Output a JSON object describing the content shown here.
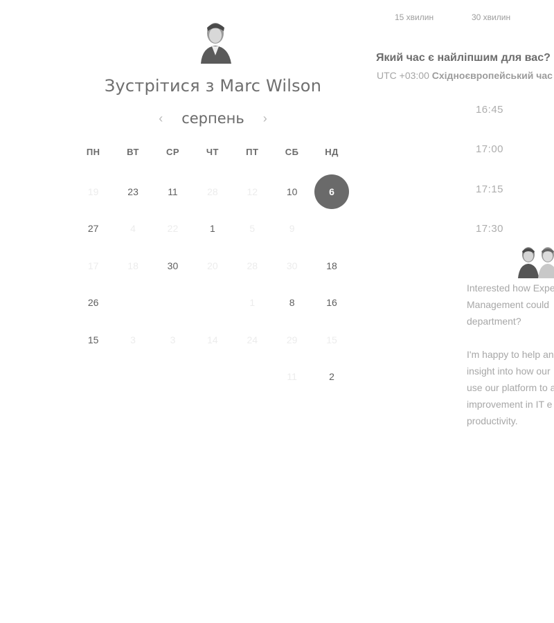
{
  "host": {
    "title": "Зустрітися з Marc Wilson",
    "avatar_icon": "person-portrait-icon"
  },
  "calendar": {
    "month": "серпень",
    "prev_icon": "chevron-left-icon",
    "next_icon": "chevron-right-icon",
    "weekdays": [
      "ПН",
      "ВТ",
      "СР",
      "ЧТ",
      "ПТ",
      "СБ",
      "НД"
    ],
    "weeks": [
      [
        {
          "label": "19",
          "state": "faint"
        },
        {
          "label": "23",
          "state": "active"
        },
        {
          "label": "11",
          "state": "active"
        },
        {
          "label": "28",
          "state": "faint"
        },
        {
          "label": "12",
          "state": "faint"
        },
        {
          "label": "10",
          "state": "active"
        },
        {
          "label": "6",
          "state": "selected"
        }
      ],
      [
        {
          "label": "27",
          "state": "active"
        },
        {
          "label": "4",
          "state": "faint"
        },
        {
          "label": "22",
          "state": "faint"
        },
        {
          "label": "1",
          "state": "active"
        },
        {
          "label": "5",
          "state": "faint"
        },
        {
          "label": "9",
          "state": "faint"
        },
        {
          "label": "",
          "state": "faint"
        }
      ],
      [
        {
          "label": "17",
          "state": "faint"
        },
        {
          "label": "18",
          "state": "faint"
        },
        {
          "label": "30",
          "state": "active"
        },
        {
          "label": "20",
          "state": "faint"
        },
        {
          "label": "28",
          "state": "faint"
        },
        {
          "label": "30",
          "state": "faint"
        },
        {
          "label": "18",
          "state": "active"
        }
      ],
      [
        {
          "label": "26",
          "state": "active"
        },
        {
          "label": "",
          "state": "faint"
        },
        {
          "label": "",
          "state": "faint"
        },
        {
          "label": "",
          "state": "faint"
        },
        {
          "label": "1",
          "state": "faint"
        },
        {
          "label": "8",
          "state": "active"
        },
        {
          "label": "16",
          "state": "active"
        }
      ],
      [
        {
          "label": "15",
          "state": "active"
        },
        {
          "label": "3",
          "state": "faint"
        },
        {
          "label": "3",
          "state": "faint"
        },
        {
          "label": "14",
          "state": "faint"
        },
        {
          "label": "24",
          "state": "faint"
        },
        {
          "label": "29",
          "state": "faint"
        },
        {
          "label": "15",
          "state": "faint"
        }
      ],
      [
        {
          "label": "",
          "state": "faint"
        },
        {
          "label": "",
          "state": "faint"
        },
        {
          "label": "",
          "state": "faint"
        },
        {
          "label": "",
          "state": "faint"
        },
        {
          "label": "",
          "state": "faint"
        },
        {
          "label": "11",
          "state": "faint"
        },
        {
          "label": "2",
          "state": "active"
        }
      ]
    ]
  },
  "times": {
    "durations": [
      "15 хвилин",
      "30 хвилин"
    ],
    "question": "Який час є найліпшим для вас?",
    "timezone_prefix": "UTC +03:00",
    "timezone_name": "Східноєвропейський час",
    "slots": [
      "16:45",
      "17:00",
      "17:15",
      "17:30"
    ]
  },
  "about": {
    "team_icon": "team-avatars-icon",
    "lines_1": [
      "Interested how Expe",
      "Management could",
      "department?"
    ],
    "lines_2": [
      "I'm happy to help an",
      "insight into how our",
      "use our platform to a",
      "improvement in IT e",
      "productivity."
    ]
  }
}
